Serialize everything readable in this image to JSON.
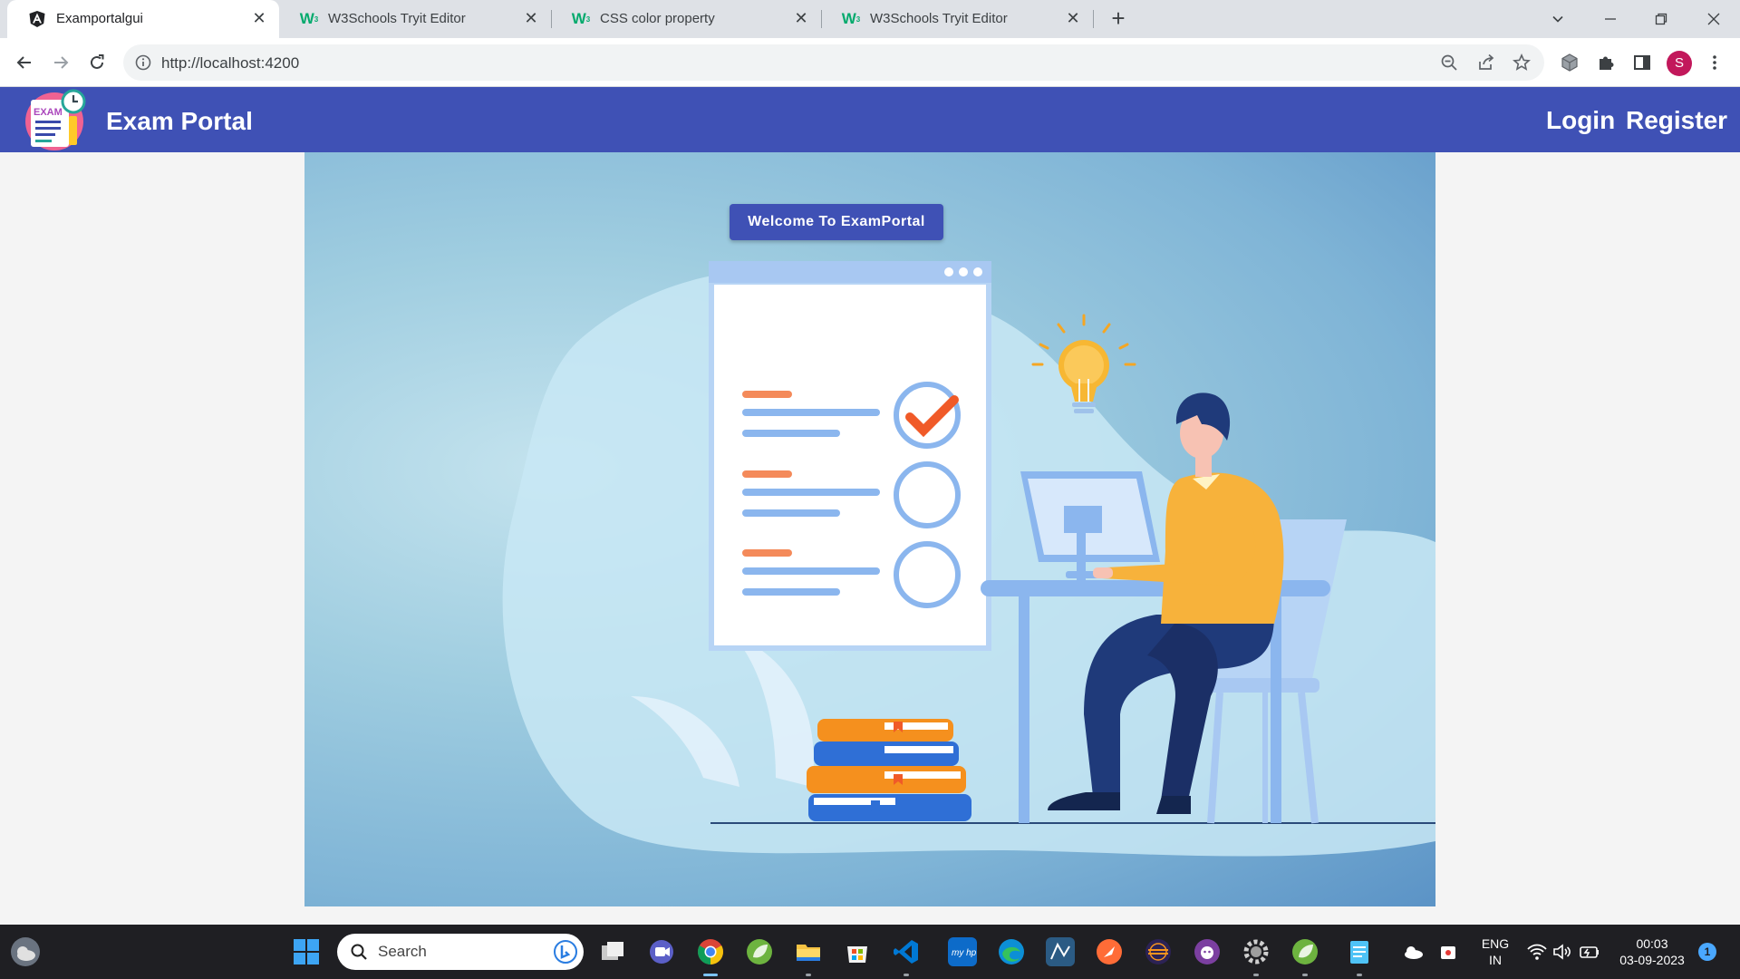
{
  "browser": {
    "tabs": [
      {
        "title": "Examportalgui",
        "icon": "angular-icon",
        "active": true
      },
      {
        "title": "W3Schools Tryit Editor",
        "icon": "w3schools-icon",
        "active": false
      },
      {
        "title": "CSS color property",
        "icon": "w3schools-icon",
        "active": false
      },
      {
        "title": "W3Schools Tryit Editor",
        "icon": "w3schools-icon",
        "active": false
      }
    ],
    "new_tab_label": "+",
    "url": "http://localhost:4200",
    "profile_initial": "S"
  },
  "navbar": {
    "brand": "Exam Portal",
    "logo_text": "EXAM",
    "login": "Login",
    "register": "Register",
    "color": "#3f51b5"
  },
  "hero": {
    "welcome_button": "Welcome To ExamPortal",
    "illustration": "person-at-computer-with-checklist-books-lightbulb"
  },
  "taskbar": {
    "search_placeholder": "Search",
    "language": "ENG",
    "region": "IN",
    "time": "00:03",
    "date": "03-09-2023",
    "notification_count": "1",
    "apps": [
      "start-icon",
      "teams-icon",
      "task-view-icon",
      "chrome-icon",
      "spring-tools-icon",
      "file-explorer-icon",
      "microsoft-store-icon",
      "vscode-icon",
      "myhp-icon",
      "edge-icon",
      "mysql-workbench-icon",
      "postman-icon",
      "eclipse-icon",
      "github-desktop-icon",
      "settings-icon",
      "spring-tools-icon-2",
      "notepad-icon"
    ]
  }
}
